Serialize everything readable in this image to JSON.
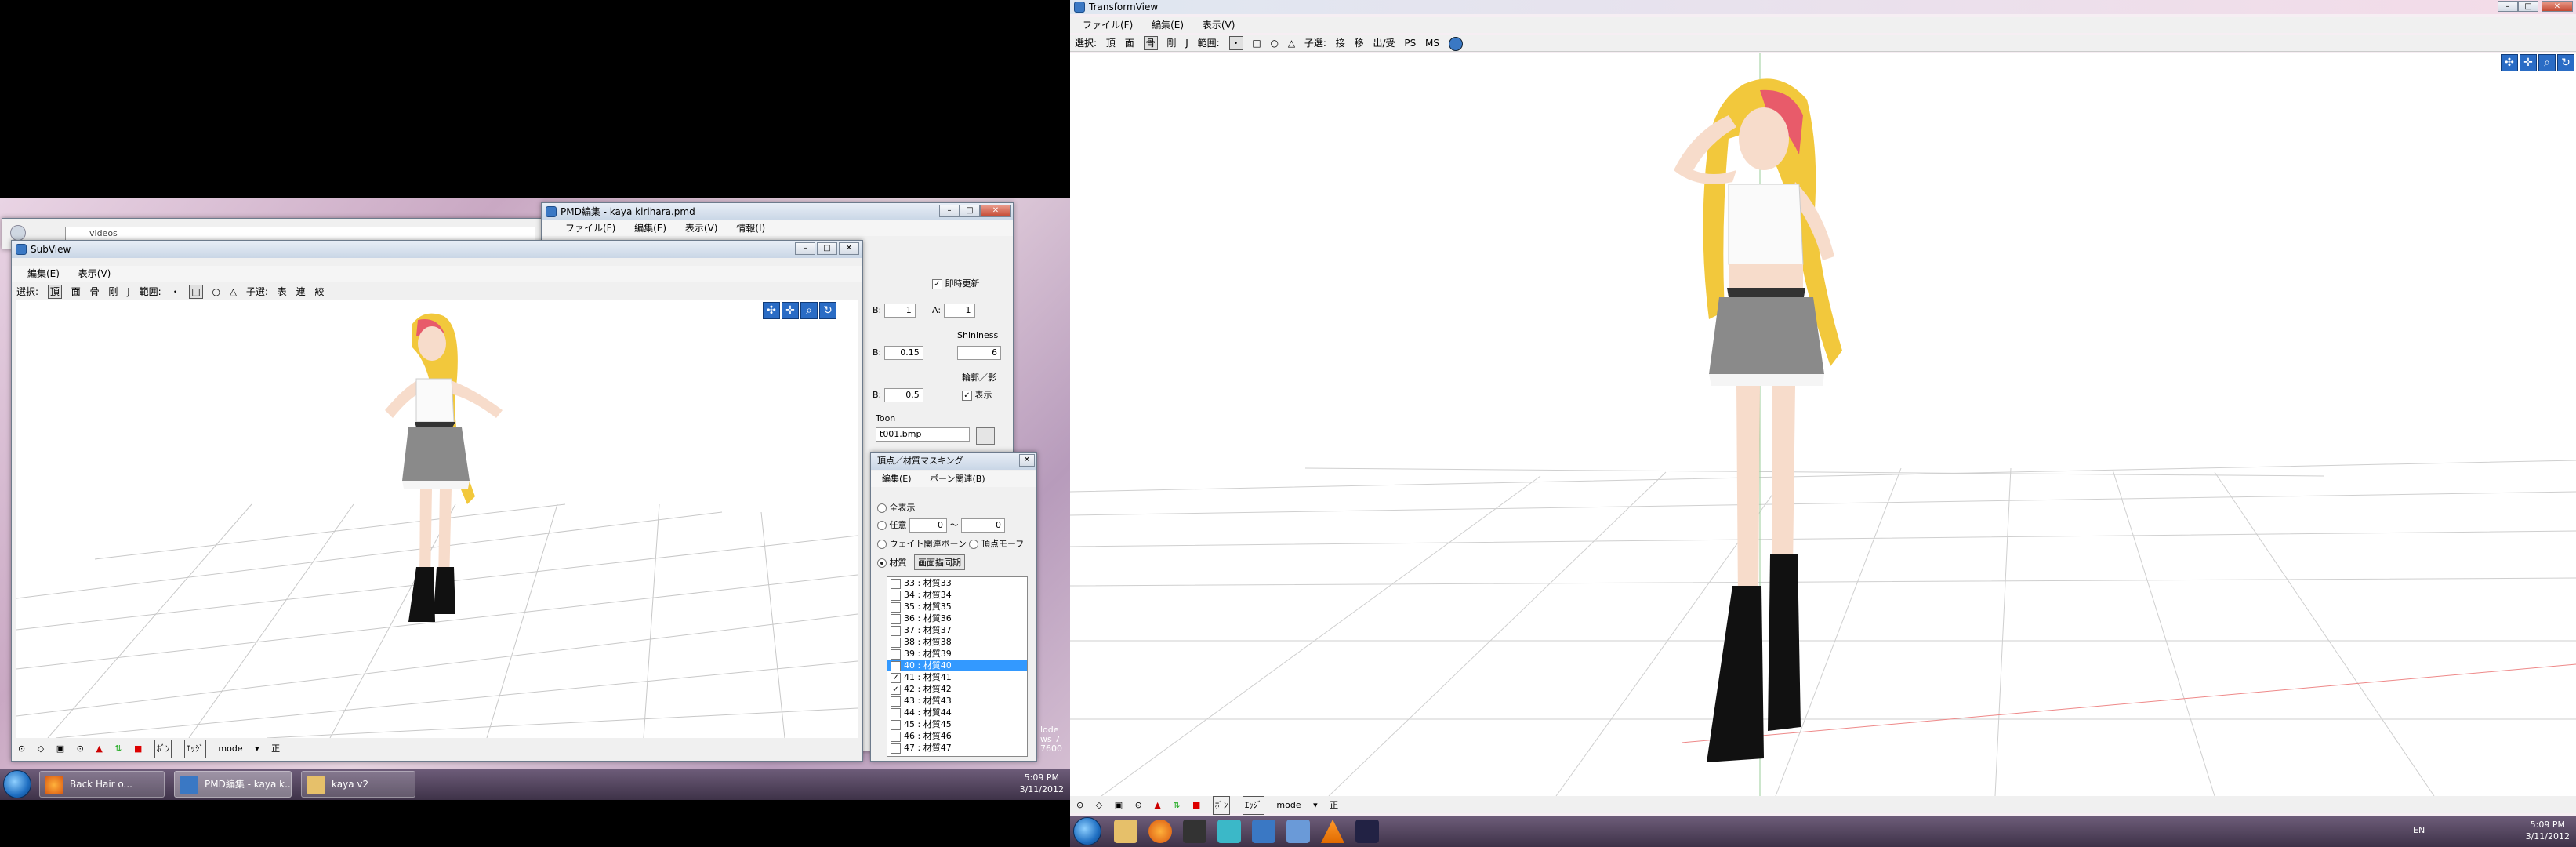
{
  "subview": {
    "title": "SubView",
    "menu": [
      "編集(E)",
      "表示(V)"
    ],
    "toolbar": {
      "select_label": "選択:",
      "items": [
        "頂",
        "面",
        "骨",
        "剛",
        "J"
      ],
      "range_label": "範囲:",
      "range_items": [
        "・",
        "□",
        "○",
        "△"
      ],
      "child_label": "子選:",
      "child_items": [
        "表",
        "連",
        "絞"
      ]
    },
    "status": {
      "mode_label": "mode",
      "items": [
        "ﾎﾞﾝ",
        "ｴｯｼﾞ"
      ],
      "last": "正"
    }
  },
  "explorer": {
    "path": "videos"
  },
  "pmd": {
    "title": "PMD編集 - kaya kirihara.pmd",
    "menu": [
      "ファイル(F)",
      "編集(E)",
      "表示(V)",
      "情報(I)"
    ],
    "material": {
      "realtime_label": "即時更新",
      "b1_label": "B:",
      "b1_value": "1",
      "a_label": "A:",
      "a_value": "1",
      "shininess_label": "Shininess",
      "b2_label": "B:",
      "b2_value": "0.15",
      "shininess_value": "6",
      "edge_label": "輪郭／影",
      "b3_label": "B:",
      "b3_value": "0.5",
      "display_label": "表示",
      "toon_label": "Toon",
      "toon_value": "t001.bmp"
    }
  },
  "masking": {
    "title": "頂点／材質マスキング",
    "menu": [
      "編集(E)",
      "ボーン関連(B)"
    ],
    "opt_all": "全表示",
    "opt_any": "任意",
    "opt_any_from": "0",
    "tilde": "〜",
    "opt_any_to": "0",
    "opt_weight": "ウェイト関連ボーン",
    "opt_vertex_morph": "頂点モーフ",
    "opt_material": "材質",
    "sync_button": "画面描同期",
    "rows": [
      {
        "label": "33 : 材質33",
        "checked": false
      },
      {
        "label": "34 : 材質34",
        "checked": false
      },
      {
        "label": "35 : 材質35",
        "checked": false
      },
      {
        "label": "36 : 材質36",
        "checked": false
      },
      {
        "label": "37 : 材質37",
        "checked": false
      },
      {
        "label": "38 : 材質38",
        "checked": false
      },
      {
        "label": "39 : 材質39",
        "checked": false
      },
      {
        "label": "40 : 材質40",
        "checked": true,
        "selected": true
      },
      {
        "label": "41 : 材質41",
        "checked": true
      },
      {
        "label": "42 : 材質42",
        "checked": true
      },
      {
        "label": "43 : 材質43",
        "checked": false
      },
      {
        "label": "44 : 材質44",
        "checked": false
      },
      {
        "label": "45 : 材質45",
        "checked": false
      },
      {
        "label": "46 : 材質46",
        "checked": false
      },
      {
        "label": "47 : 材質47",
        "checked": false
      }
    ]
  },
  "background_text": {
    "side1": "lode",
    "side2": "ws 7",
    "side3": "7600"
  },
  "taskbar_left": {
    "items": [
      "Back Hair o...",
      "PMD編集 - kaya k...",
      "kaya v2"
    ],
    "time": "5:09 PM",
    "date": "3/11/2012"
  },
  "transformview": {
    "title": "TransformView",
    "menu": [
      "ファイル(F)",
      "編集(E)",
      "表示(V)"
    ],
    "toolbar": {
      "select_label": "選択:",
      "items": [
        "頂",
        "面",
        "骨",
        "剛",
        "J"
      ],
      "range_label": "範囲:",
      "range_items": [
        "・",
        "□",
        "○",
        "△"
      ],
      "child_label": "子選:",
      "child_items": [
        "接",
        "移",
        "出/受",
        "PS",
        "MS"
      ]
    },
    "status": {
      "mode_label": "mode",
      "items": [
        "ﾎﾞﾝ",
        "ｴｯｼﾞ"
      ],
      "last": "正"
    }
  },
  "taskbar_right": {
    "lang": "EN",
    "time": "5:09 PM",
    "date": "3/11/2012"
  },
  "colors": {
    "accent": "#3399ff",
    "title_bar": "#c9d6e6",
    "skirt": "#8a8a8a",
    "hair": "#f2c83c",
    "hair_accent": "#e85b6a"
  }
}
